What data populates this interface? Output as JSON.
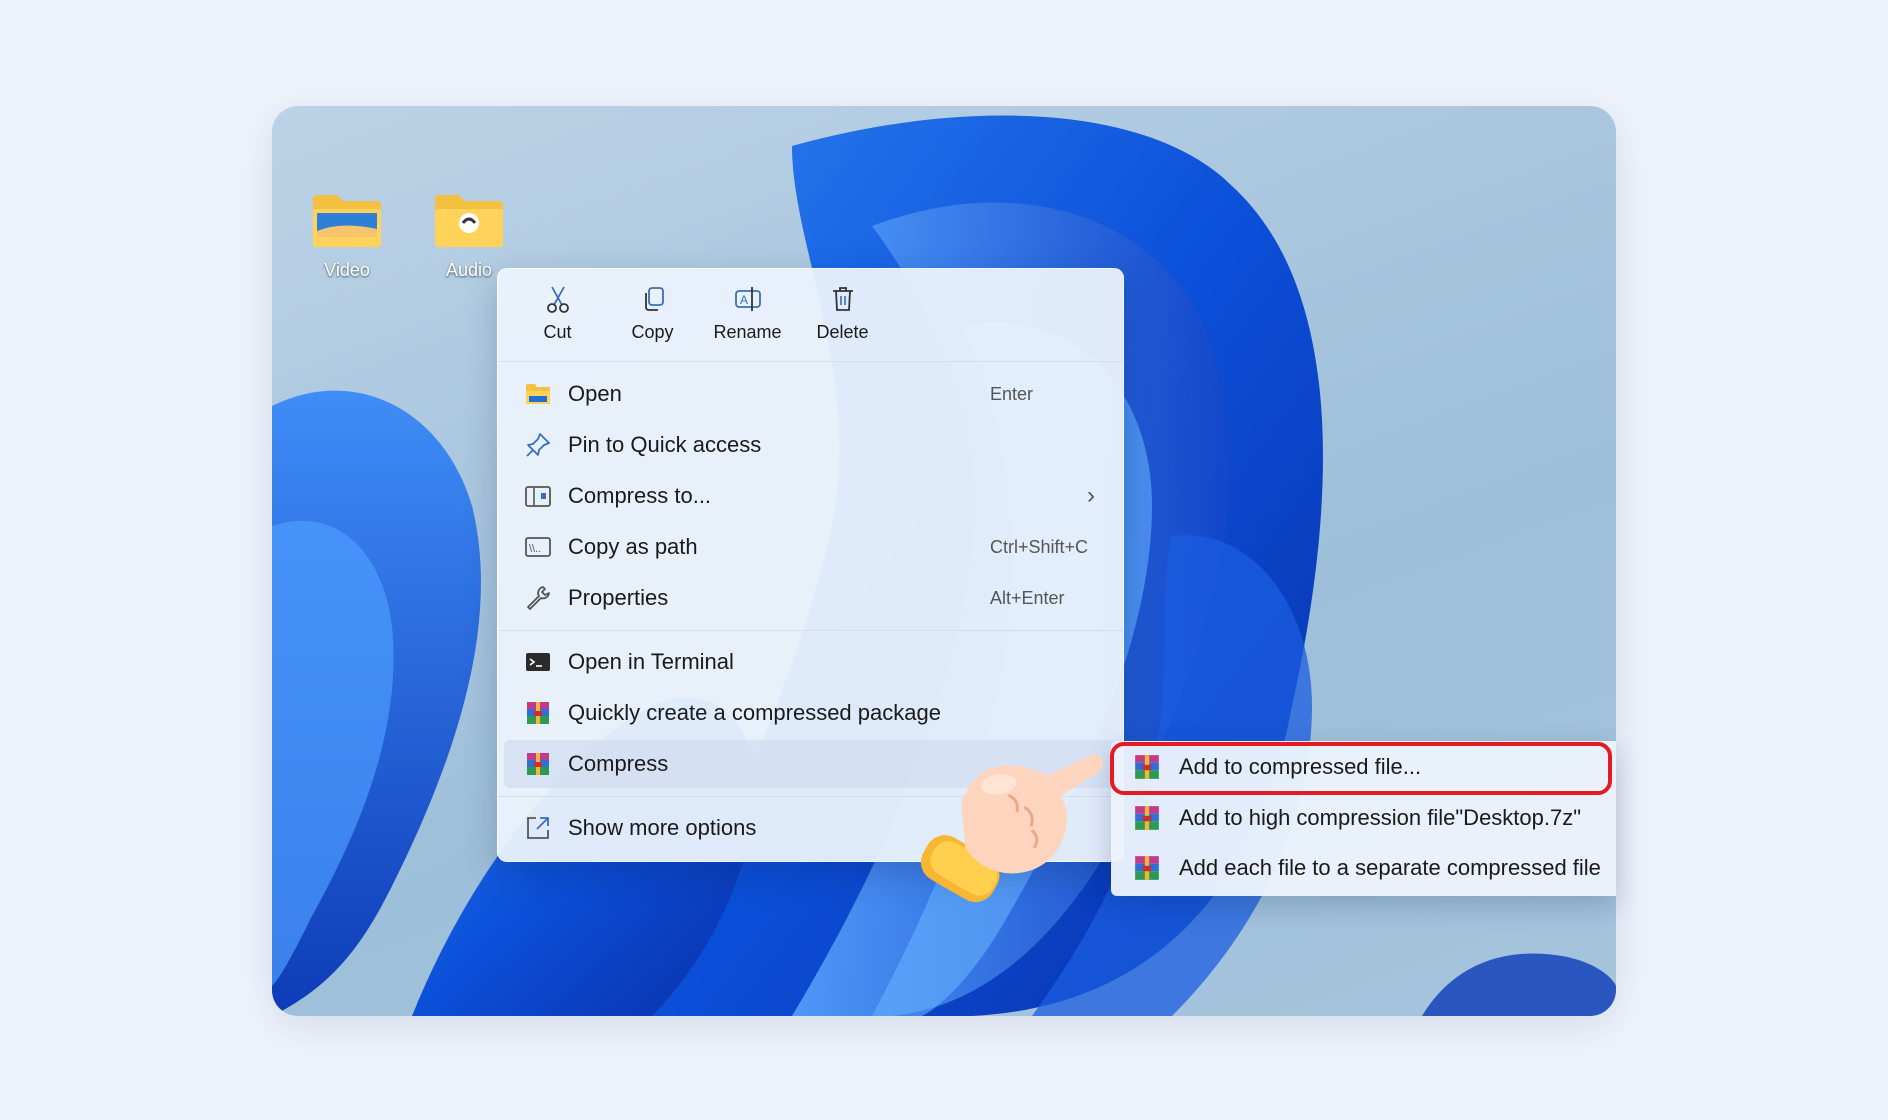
{
  "desktop": {
    "icons": [
      {
        "label": "Video"
      },
      {
        "label": "Audio"
      }
    ]
  },
  "context_menu": {
    "toolbar": [
      {
        "label": "Cut",
        "icon": "cut-icon"
      },
      {
        "label": "Copy",
        "icon": "copy-icon"
      },
      {
        "label": "Rename",
        "icon": "rename-icon"
      },
      {
        "label": "Delete",
        "icon": "delete-icon"
      }
    ],
    "items": [
      {
        "label": "Open",
        "shortcut": "Enter",
        "icon": "folder-icon"
      },
      {
        "label": "Pin to Quick access",
        "shortcut": "",
        "icon": "pin-icon"
      },
      {
        "label": "Compress to...",
        "shortcut": "",
        "icon": "zip-folder-icon"
      },
      {
        "label": "Copy as path",
        "shortcut": "Ctrl+Shift+C",
        "icon": "path-icon"
      },
      {
        "label": "Properties",
        "shortcut": "Alt+Enter",
        "icon": "wrench-icon"
      },
      {
        "label": "Open in Terminal",
        "shortcut": "",
        "icon": "terminal-icon"
      },
      {
        "label": "Quickly create a compressed package",
        "shortcut": "",
        "icon": "archive-icon"
      },
      {
        "label": "Compress",
        "shortcut": "",
        "icon": "archive-icon"
      },
      {
        "label": "Show more options",
        "shortcut": "",
        "icon": "expand-icon"
      }
    ]
  },
  "submenu": {
    "items": [
      {
        "label": "Add to compressed file...",
        "icon": "archive-icon",
        "highlighted": true
      },
      {
        "label": "Add to high compression file\"Desktop.7z\"",
        "icon": "archive-icon"
      },
      {
        "label": "Add each file to a separate compressed file",
        "icon": "archive-icon"
      }
    ]
  },
  "colors": {
    "highlight_border": "#e41b23",
    "menu_bg": "#ecf3fc",
    "accent_blue": "#1f6fd6"
  }
}
